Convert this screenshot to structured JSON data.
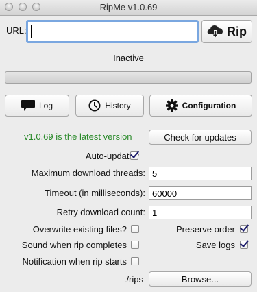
{
  "window": {
    "title": "RipMe v1.0.69"
  },
  "url": {
    "label": "URL:",
    "value": "",
    "placeholder": ""
  },
  "rip_button": {
    "label": "Rip",
    "icon": "cloud-download-icon"
  },
  "status_text": "Inactive",
  "progress": {
    "fraction": 0
  },
  "tabs": [
    {
      "label": "Log",
      "icon": "speech-bubble-icon"
    },
    {
      "label": "History",
      "icon": "clock-icon"
    },
    {
      "label": "Configuration",
      "icon": "gear-icon"
    }
  ],
  "config": {
    "version_text": "v1.0.69 is the latest version",
    "version_color": "#2a8a2a",
    "check_updates_label": "Check for updates",
    "auto_update": {
      "label": "Auto-update?",
      "checked": true
    },
    "max_threads": {
      "label": "Maximum download threads:",
      "value": "5"
    },
    "timeout": {
      "label": "Timeout (in milliseconds):",
      "value": "60000"
    },
    "retry": {
      "label": "Retry download count:",
      "value": "1"
    },
    "overwrite": {
      "label": "Overwrite existing files?",
      "checked": false
    },
    "preserve_order": {
      "label": "Preserve order",
      "checked": true
    },
    "sound": {
      "label": "Sound when rip completes",
      "checked": false
    },
    "save_logs": {
      "label": "Save logs",
      "checked": true
    },
    "notification": {
      "label": "Notification when rip starts",
      "checked": false
    },
    "save_dir": {
      "label": "./rips",
      "browse_label": "Browse..."
    }
  }
}
